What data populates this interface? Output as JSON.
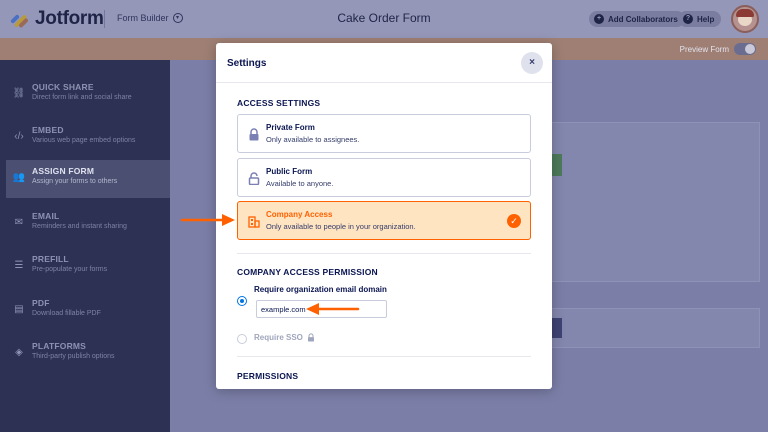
{
  "topbar": {
    "logo_text": "Jotform",
    "form_builder_label": "Form Builder",
    "title": "Cake Order Form",
    "add_collaborators_label": "Add Collaborators",
    "help_label": "Help"
  },
  "subbar": {
    "preview_label": "Preview Form"
  },
  "sidebar": {
    "items": [
      {
        "title": "QUICK SHARE",
        "subtitle": "Direct form link and social share",
        "icon": "link-icon"
      },
      {
        "title": "EMBED",
        "subtitle": "Various web page embed options",
        "icon": "code-icon"
      },
      {
        "title": "ASSIGN FORM",
        "subtitle": "Assign your forms to others",
        "icon": "users-icon",
        "active": true
      },
      {
        "title": "EMAIL",
        "subtitle": "Reminders and instant sharing",
        "icon": "envelope-icon"
      },
      {
        "title": "PREFILL",
        "subtitle": "Pre-populate your forms",
        "icon": "prefill-icon"
      },
      {
        "title": "PDF",
        "subtitle": "Download fillable PDF",
        "icon": "pdf-icon"
      },
      {
        "title": "PLATFORMS",
        "subtitle": "Third-party publish options",
        "icon": "layers-icon"
      }
    ]
  },
  "modal": {
    "title": "Settings",
    "close_label": "×",
    "access_settings_title": "ACCESS SETTINGS",
    "options": [
      {
        "title": "Private Form",
        "subtitle": "Only available to assignees.",
        "icon": "lock-icon"
      },
      {
        "title": "Public Form",
        "subtitle": "Available to anyone.",
        "icon": "unlock-icon"
      },
      {
        "title": "Company Access",
        "subtitle": "Only available to people in your organization.",
        "icon": "building-icon",
        "selected": true
      }
    ],
    "company_access_title": "COMPANY ACCESS PERMISSION",
    "require_domain_label": "Require organization email domain",
    "domain_value": "example.com",
    "require_sso_label": "Require SSO",
    "permissions_title": "PERMISSIONS"
  },
  "colors": {
    "accent": "#ff6100",
    "selected_bg": "#ffe4c2",
    "radio_blue": "#0075e3",
    "navy": "#0a1551"
  }
}
